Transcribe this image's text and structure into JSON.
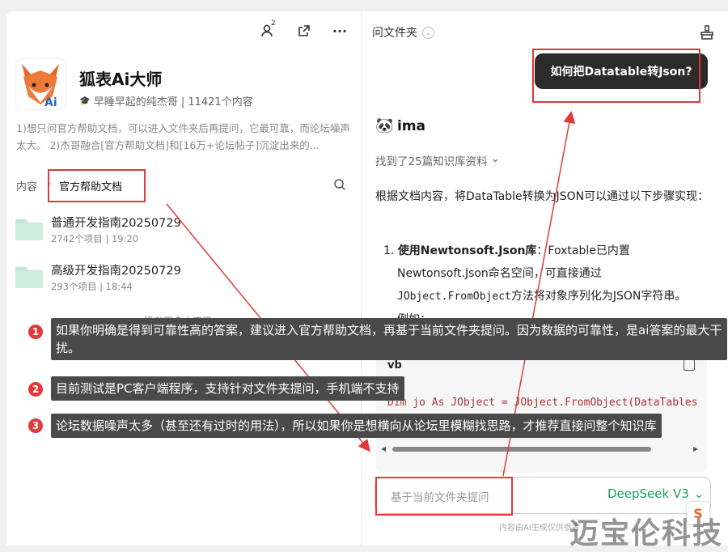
{
  "left": {
    "notif_count": "2",
    "title": "狐表Ai大师",
    "author": "早睡早起的纯杰哥 | 11421个内容",
    "description": "1)想只问官方帮助文档，可以进入文件夹后再提问，它最可靠，而论坛噪声太大。 2)杰哥融合[官方帮助文档]和[16万+论坛帖子]沉淀出来的...",
    "breadcrumb_root": "内容",
    "breadcrumb_sep": "›",
    "breadcrumb_current": "官方帮助文档",
    "folders": [
      {
        "name": "普通开发指南20250729",
        "meta": "2742个项目 | 19:20"
      },
      {
        "name": "高级开发指南20250729",
        "meta": "293个项目 | 18:44"
      }
    ],
    "footer_text": "没有更多内容了"
  },
  "right": {
    "header": "问文件夹",
    "question": "如何把Datatable转Json?",
    "bot_name": "ima",
    "found": "找到了25篇知识库资料",
    "answer_intro": "根据文档内容，将DataTable转换为JSON可以通过以下步骤实现：",
    "step_num": "1.",
    "step_bold": "使用Newtonsoft.Json库",
    "step_text1": "：Foxtable已内置",
    "step_text2": "Newtonsoft.Json命名空间，可直接通过",
    "step_code": "JObject.FromObject",
    "step_text3": "方法将对象序列化为JSON字符串。",
    "step_example": "例如：",
    "code_lang": "vb",
    "code_line": "Dim jo As JObject = JObject.FromObject(DataTables",
    "input_placeholder": "基于当前文件夹提问",
    "model": "DeepSeek V3",
    "disclaimer": "内容由AI生成仅供参考"
  },
  "annotations": [
    {
      "num": "1",
      "text": "如果你明确是得到可靠性高的答案，建议进入官方帮助文档，再基于当前文件夹提问。因为数据的可靠性，是ai答案的最大干扰。"
    },
    {
      "num": "2",
      "text": "目前测试是PC客户端程序，支持针对文件夹提问，手机端不支持"
    },
    {
      "num": "3",
      "text": "论坛数据噪声太多（甚至还有过时的用法），所以如果你是想横向从论坛里模糊找思路，才推荐直接问整个知识库"
    }
  ],
  "watermark": "迈宝伦科技",
  "colors": {
    "accent_red": "#e03a3a",
    "model_green": "#1a9e5a",
    "folder_green": "#bfe6d2"
  }
}
